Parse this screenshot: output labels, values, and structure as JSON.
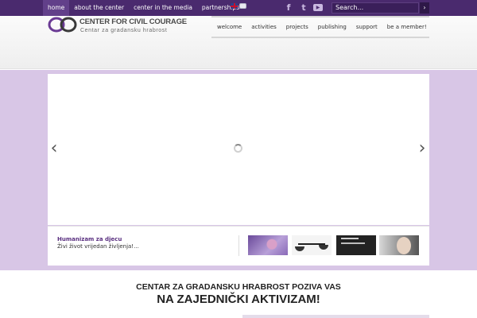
{
  "top_nav": {
    "items": [
      {
        "label": "home",
        "active": true
      },
      {
        "label": "about the center",
        "active": false
      },
      {
        "label": "center in the media",
        "active": false
      },
      {
        "label": "partnerships",
        "active": false
      }
    ]
  },
  "languages": [
    "flag-uk-icon",
    "flag-ba-icon"
  ],
  "social": [
    "facebook-icon",
    "twitter-icon",
    "youtube-icon"
  ],
  "search": {
    "placeholder": "Search..."
  },
  "logo": {
    "title": "CENTER FOR CIVIL COURAGE",
    "subtitle": "Centar za gradansku hrabrost"
  },
  "main_nav": {
    "items": [
      "welcome",
      "activities",
      "projects",
      "publishing",
      "support",
      "be a member!"
    ]
  },
  "slider": {
    "caption_title": "Humanizam za djecu",
    "caption_text": "Živi život vrijedan življenja!...",
    "thumbnail_count": 4
  },
  "headline": {
    "line1": "CENTAR ZA GRADANSKU HRABROST POZIVA VAS",
    "line2": "NA ZAJEDNIČKI AKTIVIZAM!"
  },
  "colors": {
    "top_bar": "#4a2a6e",
    "band": "#d8c6e6",
    "accent": "#5a3080"
  }
}
